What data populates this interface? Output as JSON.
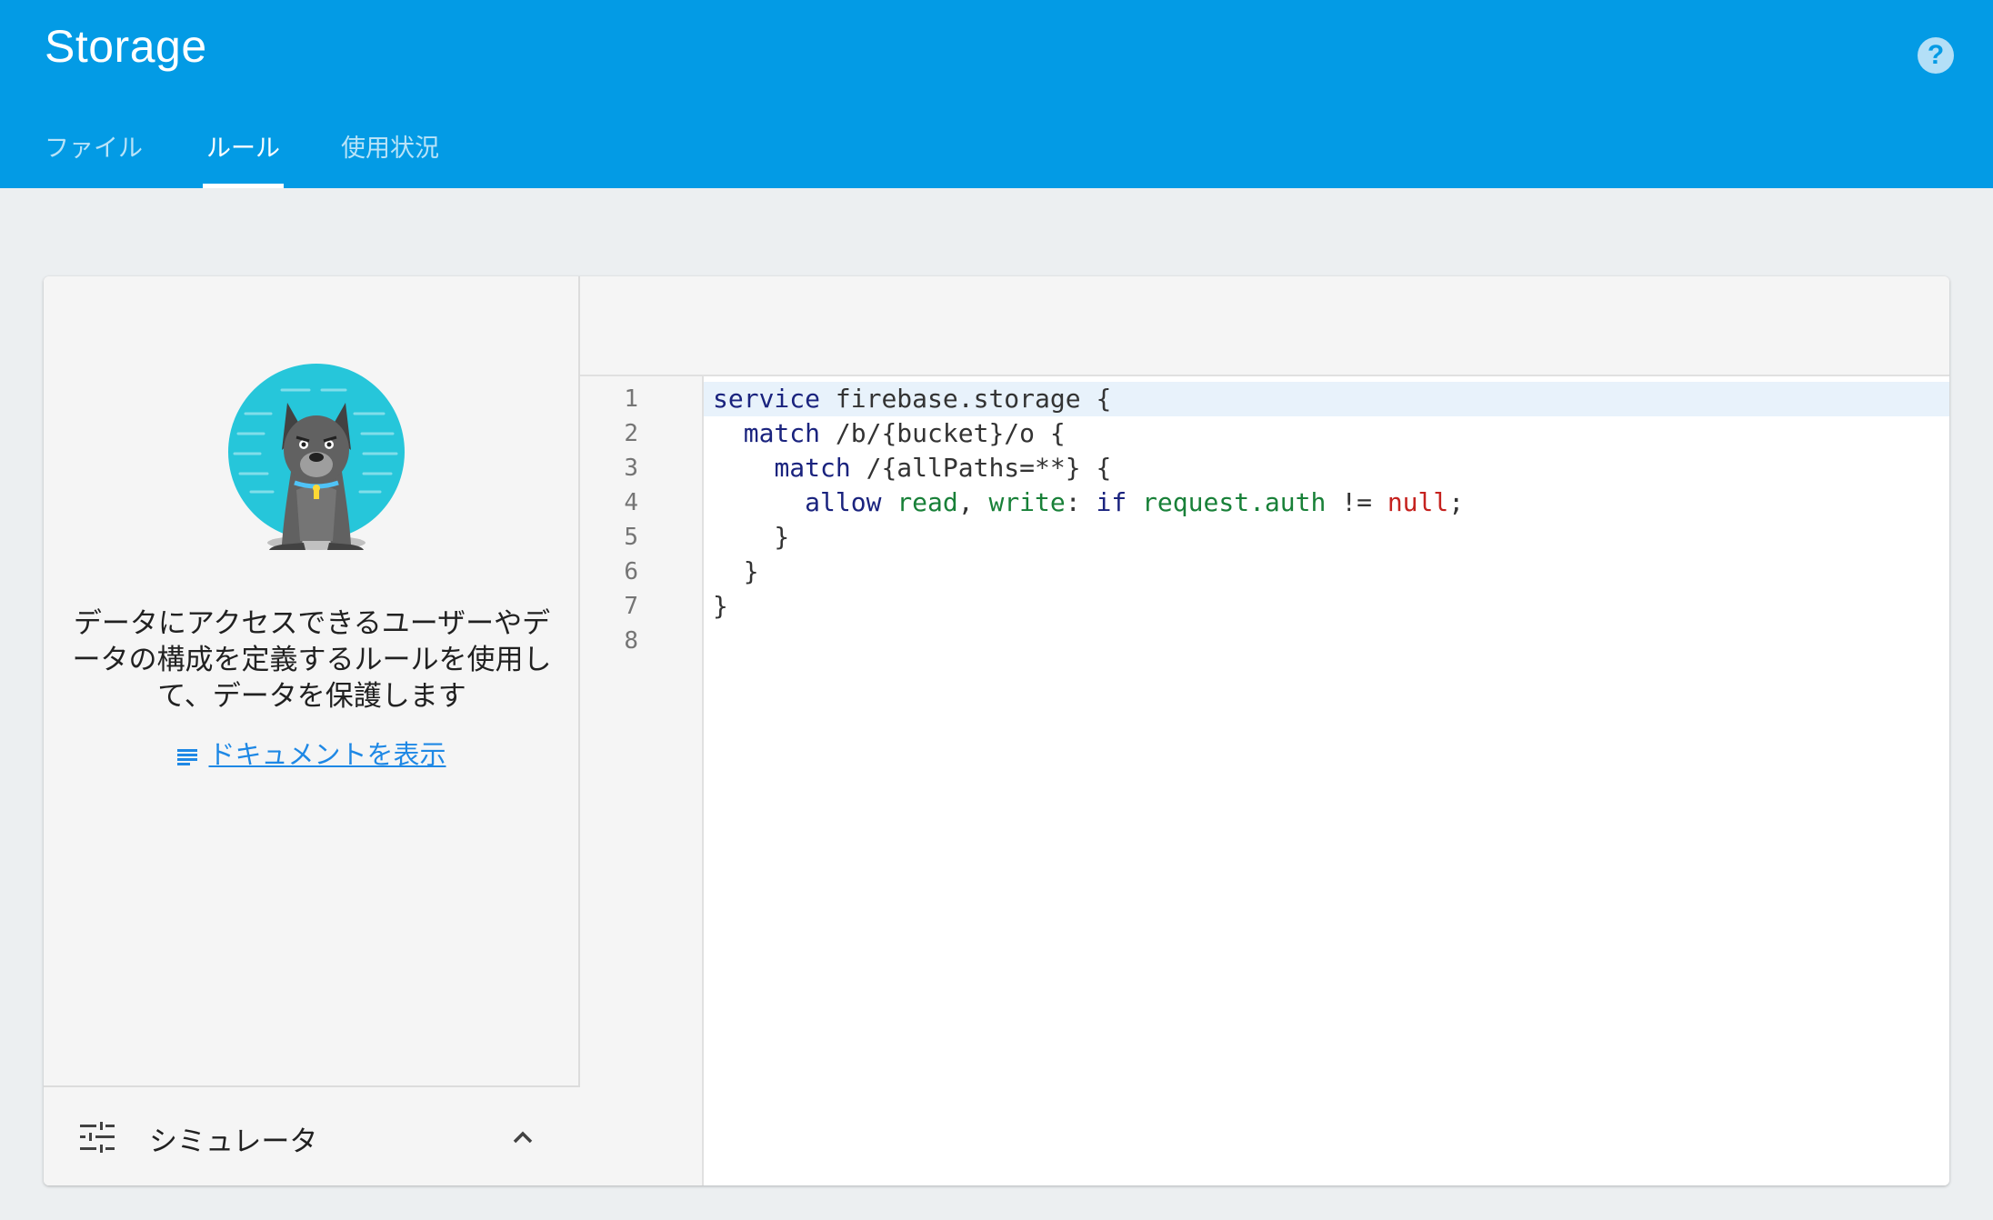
{
  "header": {
    "title": "Storage",
    "help_icon": "help-circle-icon",
    "tabs": [
      {
        "label": "ファイル",
        "active": false
      },
      {
        "label": "ルール",
        "active": true
      },
      {
        "label": "使用状況",
        "active": false
      }
    ]
  },
  "intro": {
    "mascot_icon": "security-dog-illustration",
    "description": "データにアクセスできるユーザーやデータの構成を定義するルールを使用して、データを保護します",
    "doc_link": "ドキュメントを表示",
    "doc_link_icon": "list-icon"
  },
  "simulator": {
    "label": "シミュレータ",
    "icon": "tune-icon",
    "toggle_icon": "chevron-up-icon"
  },
  "editor": {
    "line_numbers": [
      "1",
      "2",
      "3",
      "4",
      "5",
      "6",
      "7",
      "8"
    ],
    "lines": [
      "service firebase.storage {",
      "  match /b/{bucket}/o {",
      "    match /{allPaths=**} {",
      "      allow read, write: if request.auth != null;",
      "    }",
      "  }",
      "}",
      ""
    ]
  },
  "colors": {
    "header_bg": "#039be5",
    "page_bg": "#eceff1",
    "link": "#1e88e5",
    "keyword": "#1a237e",
    "identifier": "#188038",
    "null": "#c5221f"
  }
}
